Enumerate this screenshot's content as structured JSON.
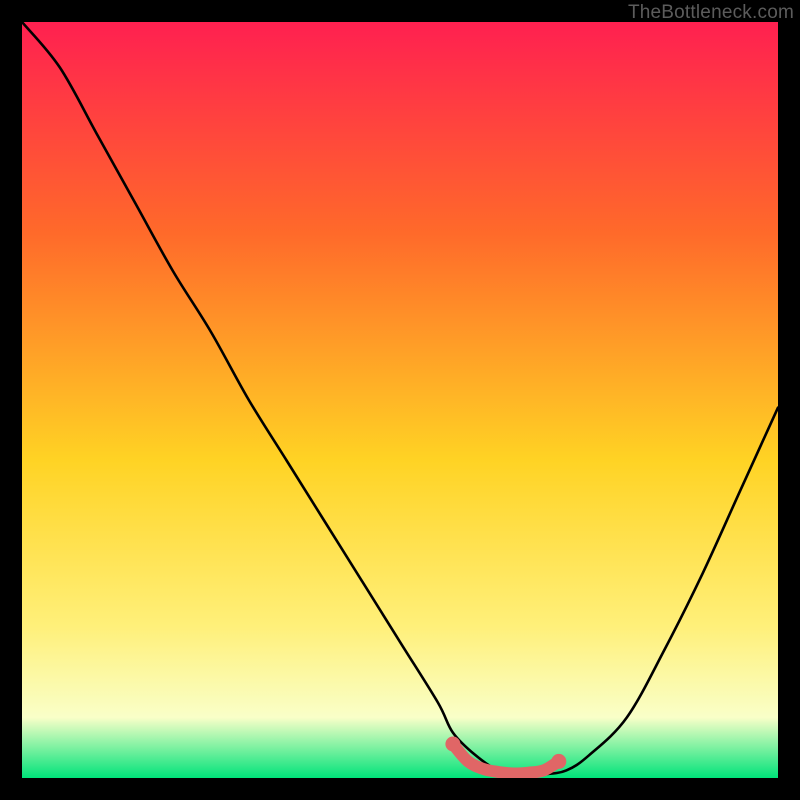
{
  "watermark": "TheBottleneck.com",
  "colors": {
    "bg": "#000000",
    "gradient_top": "#ff2050",
    "gradient_mid1": "#ff6a2a",
    "gradient_mid2": "#ffd324",
    "gradient_mid3": "#fff07a",
    "gradient_mid4": "#f9ffc8",
    "gradient_bottom": "#00e37a",
    "curve": "#000000",
    "marker_fill": "#e06666",
    "marker_stroke": "#c94f4f"
  },
  "chart_data": {
    "type": "line",
    "title": "",
    "xlabel": "",
    "ylabel": "",
    "xlim": [
      0,
      100
    ],
    "ylim": [
      0,
      100
    ],
    "series": [
      {
        "name": "bottleneck-curve",
        "x": [
          0,
          5,
          10,
          15,
          20,
          25,
          30,
          35,
          40,
          45,
          50,
          55,
          57,
          60,
          63,
          66,
          69,
          72,
          75,
          80,
          85,
          90,
          95,
          100
        ],
        "y": [
          100,
          94,
          85,
          76,
          67,
          59,
          50,
          42,
          34,
          26,
          18,
          10,
          6,
          3,
          1,
          0.5,
          0.5,
          1,
          3,
          8,
          17,
          27,
          38,
          49
        ]
      }
    ],
    "markers": {
      "name": "optimal-range",
      "x": [
        57,
        59,
        61,
        63,
        65,
        67,
        69,
        71
      ],
      "y": [
        4.5,
        2.2,
        1.2,
        0.8,
        0.6,
        0.7,
        1.0,
        2.2
      ]
    }
  }
}
